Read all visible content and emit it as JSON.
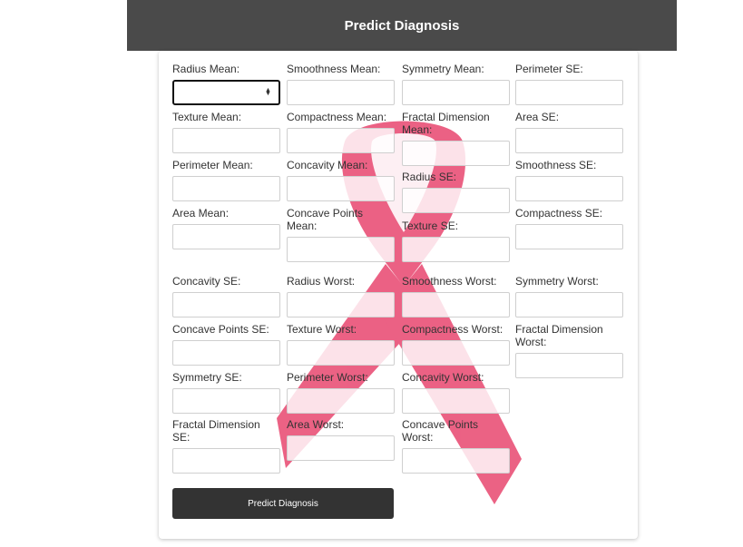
{
  "header": {
    "title": "Predict Diagnosis"
  },
  "form": {
    "columns": [
      [
        {
          "label": "Radius Mean:",
          "value": ""
        },
        {
          "label": "Texture Mean:",
          "value": ""
        },
        {
          "label": "Perimeter Mean:",
          "value": ""
        },
        {
          "label": "Area Mean:",
          "value": ""
        },
        {
          "label": "Concavity SE:",
          "value": ""
        },
        {
          "label": "Concave Points SE:",
          "value": ""
        },
        {
          "label": "Symmetry SE:",
          "value": ""
        },
        {
          "label": "Fractal Dimension SE:",
          "value": ""
        }
      ],
      [
        {
          "label": "Smoothness Mean:",
          "value": ""
        },
        {
          "label": "Compactness Mean:",
          "value": ""
        },
        {
          "label": "Concavity Mean:",
          "value": ""
        },
        {
          "label": "Concave Points Mean:",
          "value": ""
        },
        {
          "label": "Radius Worst:",
          "value": ""
        },
        {
          "label": "Texture Worst:",
          "value": ""
        },
        {
          "label": "Perimeter Worst:",
          "value": ""
        },
        {
          "label": "Area Worst:",
          "value": ""
        }
      ],
      [
        {
          "label": "Symmetry Mean:",
          "value": ""
        },
        {
          "label": "Fractal Dimension Mean:",
          "value": ""
        },
        {
          "label": "Radius SE:",
          "value": ""
        },
        {
          "label": "Texture SE:",
          "value": ""
        },
        {
          "label": "Smoothness Worst:",
          "value": ""
        },
        {
          "label": "Compactness Worst:",
          "value": ""
        },
        {
          "label": "Concavity Worst:",
          "value": ""
        },
        {
          "label": "Concave Points Worst:",
          "value": ""
        }
      ],
      [
        {
          "label": "Perimeter SE:",
          "value": ""
        },
        {
          "label": "Area SE:",
          "value": ""
        },
        {
          "label": "Smoothness SE:",
          "value": ""
        },
        {
          "label": "Compactness SE:",
          "value": ""
        },
        {
          "label": "Symmetry Worst:",
          "value": ""
        },
        {
          "label": "Fractal Dimension Worst:",
          "value": ""
        }
      ]
    ],
    "submit_label": "Predict Diagnosis"
  },
  "colors": {
    "header_bg": "#4a4a4a",
    "button_bg": "#333333",
    "ribbon": "#e8466f"
  },
  "icons": {
    "background": "pink-ribbon-icon",
    "number_spinner": "spinner-arrows-icon"
  }
}
